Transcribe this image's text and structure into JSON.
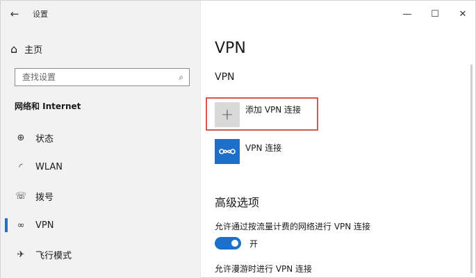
{
  "window": {
    "title": "设置",
    "back_icon": "←",
    "minimize_icon": "—",
    "maximize_icon": "☐",
    "close_icon": "✕"
  },
  "sidebar": {
    "home": {
      "icon": "⌂",
      "label": "主页"
    },
    "search": {
      "placeholder": "查找设置",
      "icon": "⌕"
    },
    "section": "网络和 Internet",
    "items": [
      {
        "icon": "⊕",
        "label": "状态"
      },
      {
        "icon": "◜",
        "label": "WLAN"
      },
      {
        "icon": "☏",
        "label": "拨号"
      },
      {
        "icon": "∞",
        "label": "VPN"
      },
      {
        "icon": "✈",
        "label": "飞行模式"
      }
    ],
    "active_index": 3
  },
  "main": {
    "title": "VPN",
    "subtitle": "VPN",
    "add_button": {
      "icon": "+",
      "label": "添加 VPN 连接"
    },
    "connection": {
      "label": "VPN 连接"
    },
    "advanced_title": "高级选项",
    "option_metered": "允许通过按流量计费的网络进行 VPN 连接",
    "toggle_label": "开",
    "option_roaming": "允许漫游时进行 VPN 连接"
  },
  "colors": {
    "accent": "#1d6fc9",
    "highlight": "#d9534f"
  }
}
